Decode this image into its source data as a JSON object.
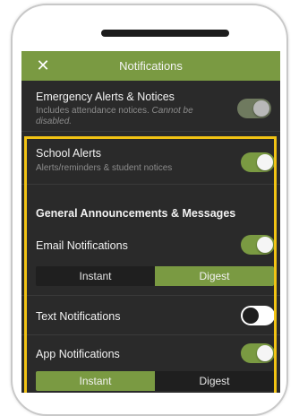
{
  "header": {
    "title": "Notifications",
    "close_icon": "close-icon"
  },
  "emergency": {
    "label": "Emergency Alerts & Notices",
    "sub_normal": "Includes attendance notices. ",
    "sub_italic": "Cannot be disabled.",
    "enabled": true,
    "locked": true
  },
  "school_alerts": {
    "label": "School Alerts",
    "sub": "Alerts/reminders & student notices",
    "enabled": true
  },
  "general": {
    "heading": "General Announcements & Messages"
  },
  "email": {
    "label": "Email Notifications",
    "enabled": true,
    "options": [
      "Instant",
      "Digest"
    ],
    "selected": "Digest"
  },
  "text": {
    "label": "Text Notifications",
    "enabled": false
  },
  "app": {
    "label": "App Notifications",
    "enabled": true,
    "options": [
      "Instant",
      "Digest"
    ],
    "selected": "Instant"
  },
  "colors": {
    "accent": "#7a9a42",
    "highlight": "#f2c314",
    "background": "#2a2a2a"
  }
}
